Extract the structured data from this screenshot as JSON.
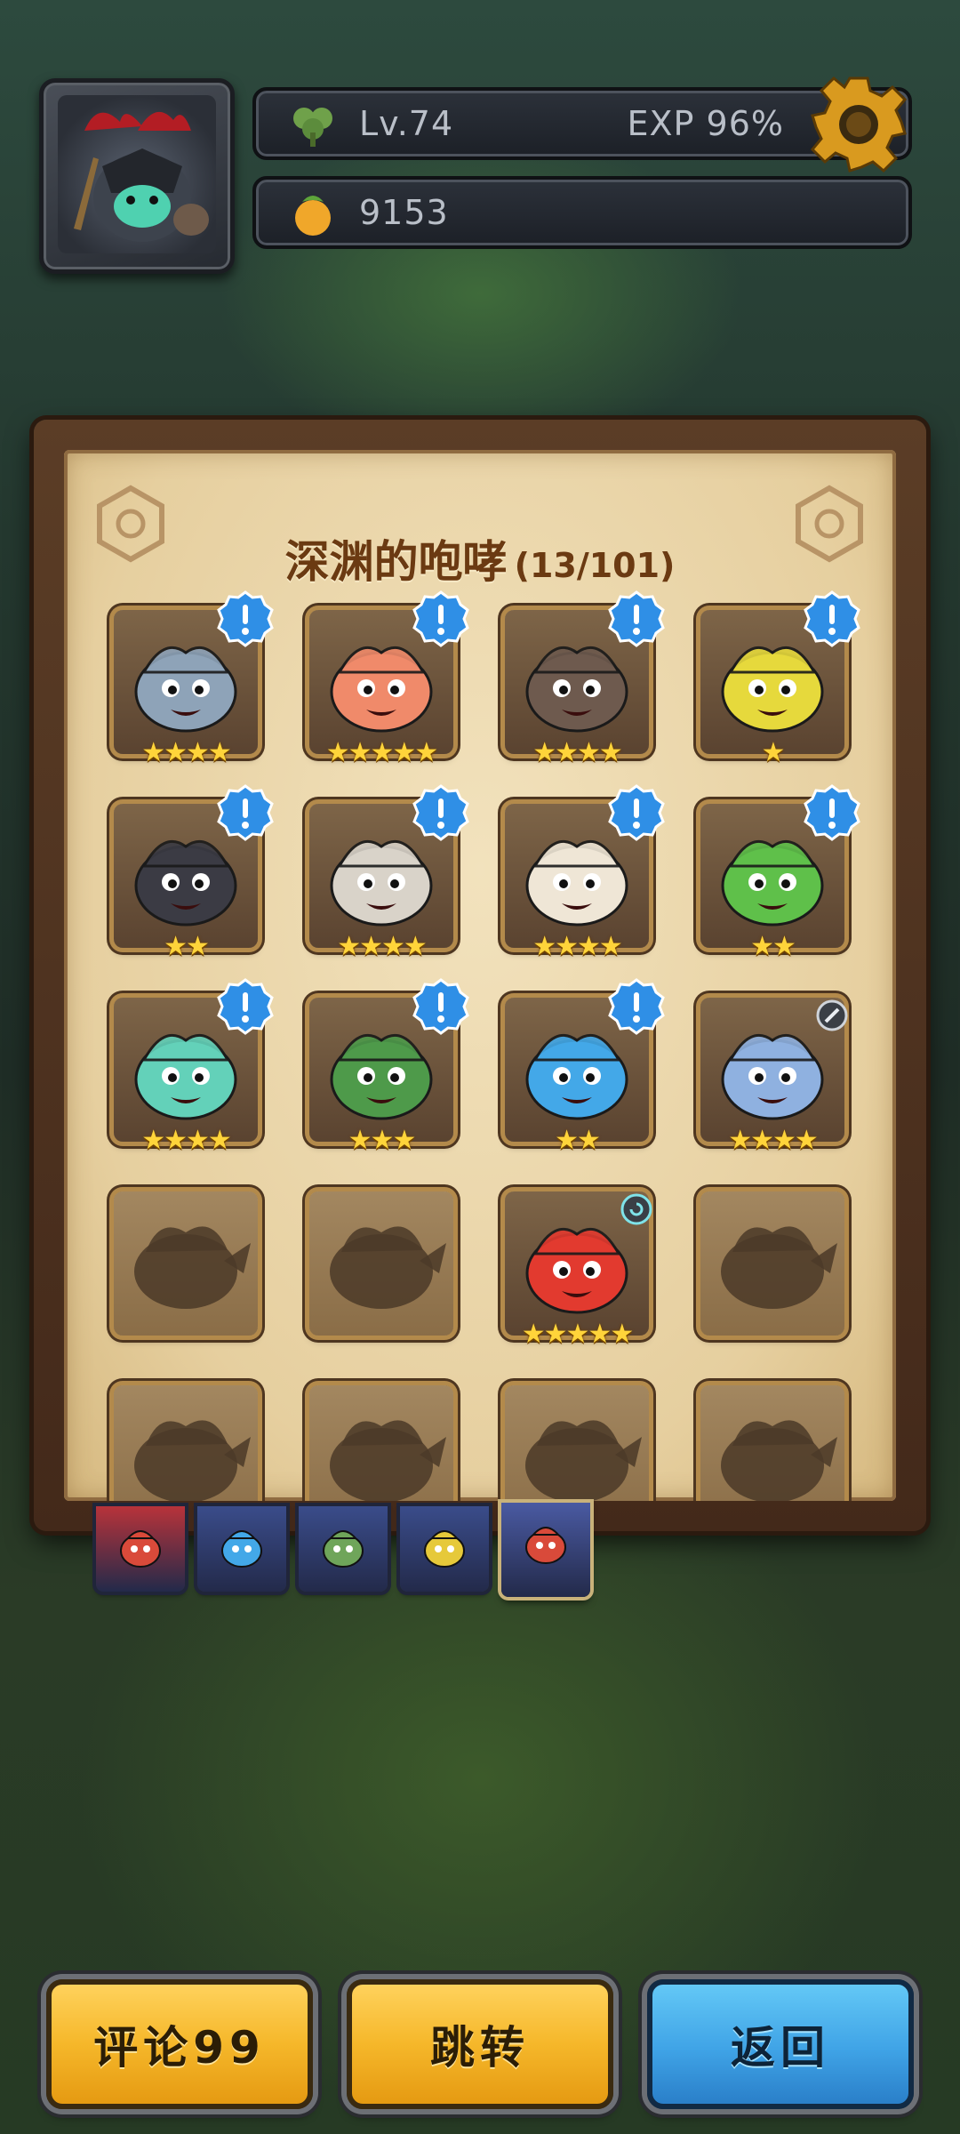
{
  "hud": {
    "level": "Lv.74",
    "exp": "EXP 96%",
    "currency": "9153"
  },
  "panel": {
    "title": "深渊的咆哮",
    "count": "(13/101)"
  },
  "cards": [
    {
      "stars": "★★★★",
      "alert": true,
      "color": "#8ea3b8",
      "state": "owned"
    },
    {
      "stars": "★★★★★",
      "alert": true,
      "color": "#f08a6a",
      "state": "owned"
    },
    {
      "stars": "★★★★",
      "alert": true,
      "color": "#6e5a4e",
      "state": "owned"
    },
    {
      "stars": "★",
      "alert": true,
      "color": "#e6d93c",
      "state": "owned"
    },
    {
      "stars": "★★",
      "alert": true,
      "color": "#3b3b44",
      "state": "owned"
    },
    {
      "stars": "★★★★",
      "alert": true,
      "color": "#d9d3c9",
      "state": "owned"
    },
    {
      "stars": "★★★★",
      "alert": true,
      "color": "#efe6d6",
      "state": "owned"
    },
    {
      "stars": "★★",
      "alert": true,
      "color": "#5fc04a",
      "state": "owned"
    },
    {
      "stars": "★★★★",
      "alert": true,
      "color": "#63d1b9",
      "state": "owned"
    },
    {
      "stars": "★★★",
      "alert": true,
      "color": "#4e9a4a",
      "state": "owned"
    },
    {
      "stars": "★★",
      "alert": true,
      "color": "#43a8e8",
      "state": "owned"
    },
    {
      "stars": "★★★★",
      "alert": false,
      "color": "#8fb1e0",
      "state": "owned"
    },
    {
      "stars": "",
      "alert": false,
      "color": "#5a4630",
      "state": "locked"
    },
    {
      "stars": "",
      "alert": false,
      "color": "#5a4630",
      "state": "locked"
    },
    {
      "stars": "★★★★★",
      "alert": false,
      "color": "#e23a2f",
      "state": "owned"
    },
    {
      "stars": "",
      "alert": false,
      "color": "#5a4630",
      "state": "locked"
    },
    {
      "stars": "",
      "alert": false,
      "color": "#5a4630",
      "state": "locked"
    },
    {
      "stars": "",
      "alert": false,
      "color": "#5a4630",
      "state": "locked"
    },
    {
      "stars": "",
      "alert": false,
      "color": "#5a4630",
      "state": "locked"
    },
    {
      "stars": "",
      "alert": false,
      "color": "#5a4630",
      "state": "locked"
    }
  ],
  "tabs": [
    {
      "icon": "red-team-icon",
      "color": "#b8333a"
    },
    {
      "icon": "blue-creature-icon",
      "color": "#3a4c8a"
    },
    {
      "icon": "green-creature-icon",
      "color": "#3a4c8a"
    },
    {
      "icon": "yellow-creature-icon",
      "color": "#3a4c8a"
    },
    {
      "icon": "red-demon-icon",
      "color": "#4a5aa2",
      "active": true
    }
  ],
  "buttons": {
    "comment": "评论99",
    "jump": "跳转",
    "back": "返回"
  },
  "colors": {
    "accent_gold": "#f5b72a",
    "accent_blue": "#3fa3e6",
    "parchment": "#e6cf9f",
    "title_brown": "#6b3a12",
    "alert_blue": "#2f8fe6",
    "star": "#ffd43a"
  }
}
